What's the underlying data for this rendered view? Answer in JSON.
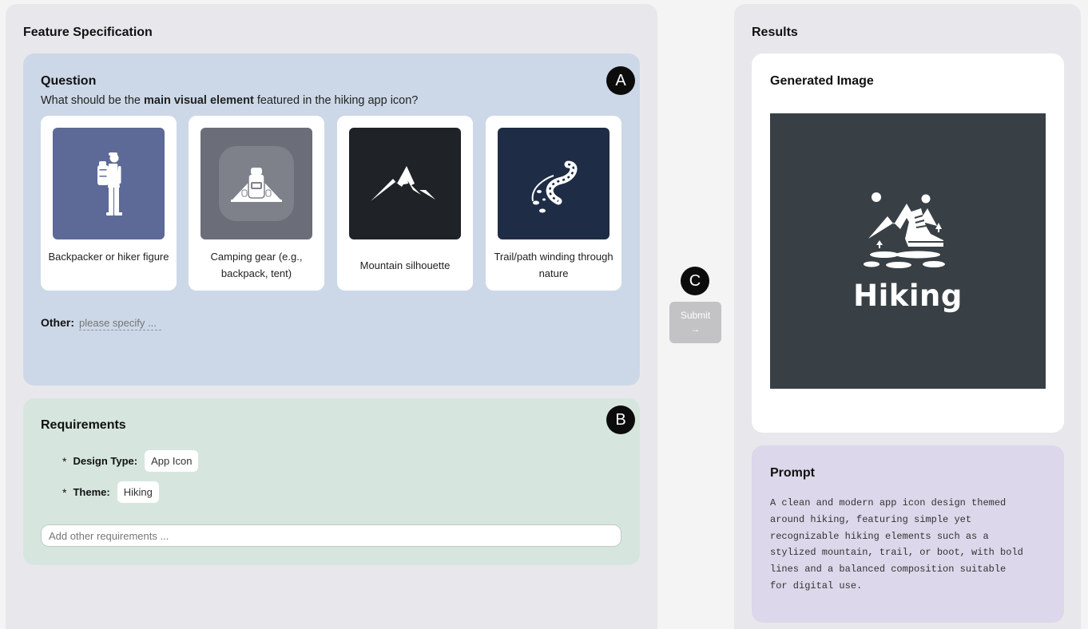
{
  "left": {
    "title": "Feature Specification",
    "question": {
      "badge": "A",
      "title": "Question",
      "text_before": "What should be the ",
      "text_bold": "main visual element",
      "text_after": " featured in the hiking app icon?",
      "options": [
        {
          "label": "Backpacker or hiker figure",
          "icon": "hiker-icon",
          "bg": "#5d6996"
        },
        {
          "label": "Camping gear (e.g., backpack, tent)",
          "icon": "backpack-tent-icon",
          "bg": "#6b6e78"
        },
        {
          "label": "Mountain silhouette",
          "icon": "mountain-icon",
          "bg": "#1f2226"
        },
        {
          "label": "Trail/path winding through nature",
          "icon": "trail-icon",
          "bg": "#1f2c45"
        }
      ],
      "other_label": "Other:",
      "other_placeholder": "please specify ..."
    },
    "requirements": {
      "badge": "B",
      "title": "Requirements",
      "items": [
        {
          "bullet": "*",
          "key": "Design Type:",
          "value": "App Icon"
        },
        {
          "bullet": "*",
          "key": "Theme:",
          "value": "Hiking"
        }
      ],
      "input_placeholder": "Add other requirements ..."
    }
  },
  "middle": {
    "badge": "C",
    "submit_label": "Submit",
    "submit_arrow": "→"
  },
  "right": {
    "title": "Results",
    "image_card": {
      "title": "Generated Image",
      "image_text": "Hiking",
      "bg": "#394045"
    },
    "prompt_card": {
      "title": "Prompt",
      "lines": [
        "A clean and modern app icon design themed",
        "around hiking, featuring simple yet",
        "recognizable hiking elements such as a",
        "stylized mountain, trail, or boot, with bold",
        "lines and a balanced composition suitable",
        "for digital use."
      ]
    }
  }
}
